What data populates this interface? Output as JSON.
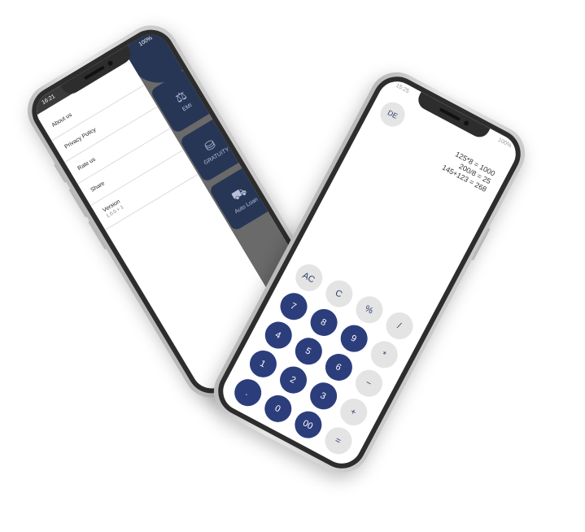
{
  "phone_menu": {
    "status_time": "16:21",
    "status_battery": "100%",
    "menu_items": [
      {
        "label": "About us"
      },
      {
        "label": "Privacy Policy"
      },
      {
        "label": "Rate us"
      },
      {
        "label": "Share"
      },
      {
        "label": "Version",
        "sub": "1.0.0 + 1"
      }
    ],
    "cards": [
      {
        "label": "EMI",
        "icon": "emi-icon"
      },
      {
        "label": "GRATUITY",
        "icon": "gratuity-icon"
      },
      {
        "label": "Auto Loan",
        "icon": "auto-loan-icon"
      }
    ],
    "colors": {
      "accent": "#283655",
      "overlay": "#6a6a6a"
    }
  },
  "phone_calc": {
    "status_time": "15:25",
    "status_battery": "100%",
    "de_label": "DE",
    "history": [
      "125*8 = 1000",
      "200/8 = 25",
      "145+123 = 268"
    ],
    "keys": [
      {
        "label": "AC",
        "style": "light"
      },
      {
        "label": "C",
        "style": "light"
      },
      {
        "label": "%",
        "style": "light"
      },
      {
        "label": "/",
        "style": "light"
      },
      {
        "label": "7",
        "style": "dark"
      },
      {
        "label": "8",
        "style": "dark"
      },
      {
        "label": "9",
        "style": "dark"
      },
      {
        "label": "*",
        "style": "light"
      },
      {
        "label": "4",
        "style": "dark"
      },
      {
        "label": "5",
        "style": "dark"
      },
      {
        "label": "6",
        "style": "dark"
      },
      {
        "label": "−",
        "style": "light"
      },
      {
        "label": "1",
        "style": "dark"
      },
      {
        "label": "2",
        "style": "dark"
      },
      {
        "label": "3",
        "style": "dark"
      },
      {
        "label": "+",
        "style": "light"
      },
      {
        "label": ".",
        "style": "dark"
      },
      {
        "label": "0",
        "style": "dark"
      },
      {
        "label": "00",
        "style": "dark"
      },
      {
        "label": "=",
        "style": "light"
      }
    ],
    "colors": {
      "key_dark": "#2c3d7c",
      "key_light": "#e4e4e4"
    }
  }
}
